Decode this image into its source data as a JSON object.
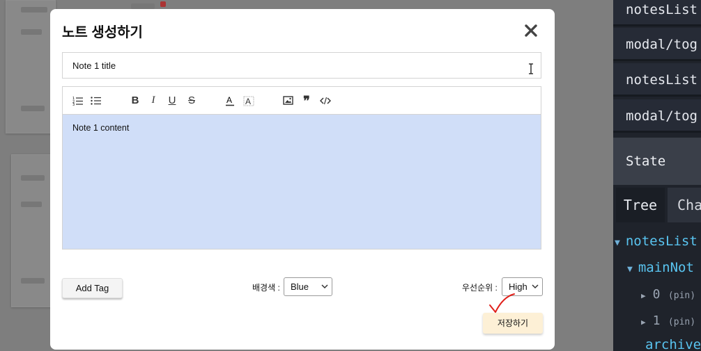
{
  "modal": {
    "title": "노트 생성하기",
    "title_input_value": "Note 1 title",
    "content_text": "Note 1 content",
    "add_tag_label": "Add Tag",
    "bg_color_label": "배경색 :",
    "bg_color_value": "Blue",
    "priority_label": "우선순위 :",
    "priority_value": "High",
    "save_label": "저장하기",
    "content_bg_color": "#d0def8",
    "save_bg_color": "#fdf0d6"
  },
  "toolbar_icons": [
    "ordered-list-icon",
    "bullet-list-icon",
    "bold-icon",
    "italic-icon",
    "underline-icon",
    "strikethrough-icon",
    "text-color-icon",
    "highlight-icon",
    "image-icon",
    "quote-icon",
    "code-icon"
  ],
  "devtools": {
    "actions": [
      "notesList",
      "modal/tog",
      "notesList",
      "modal/tog"
    ],
    "state_header": "State",
    "tabs": [
      "Tree",
      "Cha"
    ],
    "tree": {
      "root_key": "notesList",
      "child_key": "mainNot",
      "items": [
        {
          "index": "0",
          "meta": "(pin)"
        },
        {
          "index": "1",
          "meta": "(pin)"
        }
      ],
      "archive_key": "archive"
    }
  }
}
